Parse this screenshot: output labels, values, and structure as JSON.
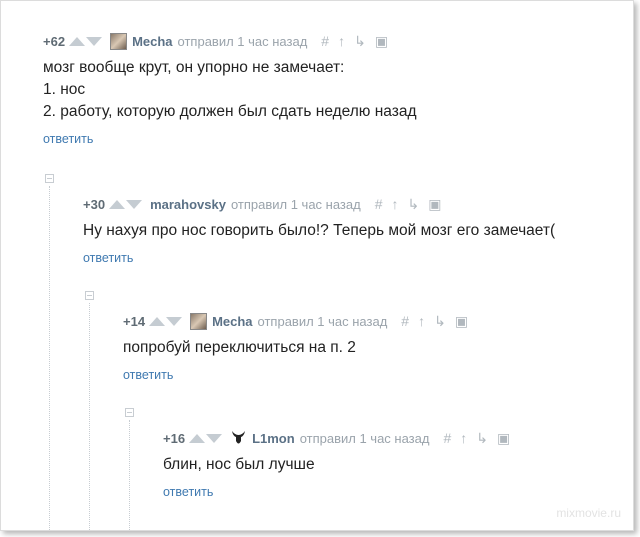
{
  "comments": [
    {
      "score": "+62",
      "author": "Mecha",
      "posted": "отправил 1 час назад",
      "lines": [
        "мозг вообще крут, он упорно не замечает:",
        "1. нос",
        "2. работу, которую должен был сдать неделю назад"
      ],
      "reply": "ответить"
    },
    {
      "score": "+30",
      "author": "marahovsky",
      "posted": "отправил 1 час назад",
      "lines": [
        "Ну нахуя про нос говорить было!? Теперь мой мозг его замечает("
      ],
      "reply": "ответить"
    },
    {
      "score": "+14",
      "author": "Mecha",
      "posted": "отправил 1 час назад",
      "lines": [
        "попробуй переключиться на п. 2"
      ],
      "reply": "ответить"
    },
    {
      "score": "+16",
      "author": "L1mon",
      "posted": "отправил 1 час назад",
      "lines": [
        "блин, нос был лучше"
      ],
      "reply": "ответить"
    }
  ],
  "icons": [
    "hash-icon",
    "parent-icon",
    "branch-icon",
    "save-icon"
  ],
  "watermark": "mixmovie.ru"
}
